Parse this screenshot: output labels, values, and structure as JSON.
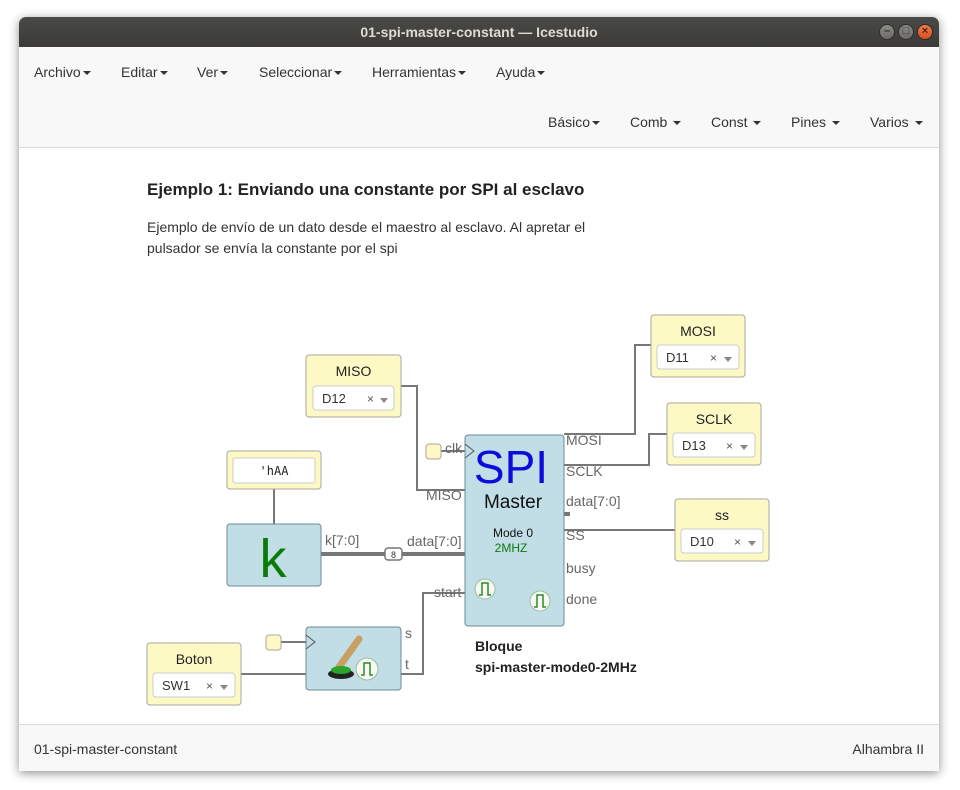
{
  "window": {
    "title": "01-spi-master-constant — Icestudio"
  },
  "menu": [
    "Archivo",
    "Editar",
    "Ver",
    "Seleccionar",
    "Herramientas",
    "Ayuda"
  ],
  "palette": [
    "Básico",
    "Comb",
    "Const",
    "Pines",
    "Varios"
  ],
  "doc": {
    "title": "Ejemplo 1: Enviando una constante por SPI al esclavo",
    "description": "Ejemplo de envío de un dato desde el maestro al esclavo. Al apretar el pulsador se envía la constante por el spi"
  },
  "blocks": {
    "miso": {
      "label": "MISO",
      "pin": "D12"
    },
    "mosi": {
      "label": "MOSI",
      "pin": "D11"
    },
    "sclk": {
      "label": "SCLK",
      "pin": "D13"
    },
    "ss": {
      "label": "ss",
      "pin": "D10"
    },
    "boton": {
      "label": "Boton",
      "pin": "SW1"
    },
    "constant": {
      "value": "'hAA",
      "symbol": "k",
      "out_port": "k[7:0]"
    },
    "spi": {
      "name": "SPI",
      "subtitle": "Master",
      "mode": "Mode 0",
      "freq": "2MHZ",
      "inputs": [
        "clk",
        "MISO",
        "data[7:0]",
        "start"
      ],
      "outputs": [
        "MOSI",
        "SCLK",
        "data[7:0]",
        "SS",
        "busy",
        "done"
      ],
      "caption_line1": "Bloque",
      "caption_line2": "spi-master-mode0-2MHz"
    },
    "button_block": {
      "outputs": [
        "s",
        "t"
      ]
    },
    "bus_width": "8",
    "pin_clear": "×"
  },
  "status": {
    "left": "01-spi-master-constant",
    "right": "Alhambra II"
  },
  "colors": {
    "pin_block": "#fdf9c5",
    "module_block": "#c1dee6",
    "constant_symbol": "#0a7a0a",
    "spi_title": "#0c0cdc",
    "freq": "#0a7a0a",
    "titlebar": "#3f3e3b",
    "close_button": "#e2612e"
  },
  "icons": {
    "window_controls": [
      "minimize-icon",
      "maximize-icon",
      "close-icon"
    ],
    "pulse": "pulse-icon",
    "dropdown": "chevron-down-icon"
  }
}
